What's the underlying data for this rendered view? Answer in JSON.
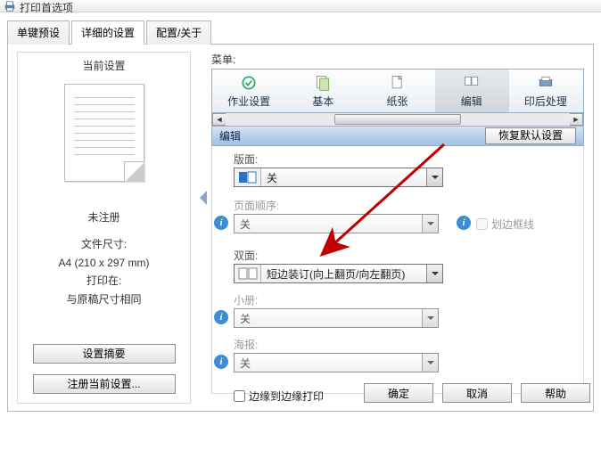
{
  "window": {
    "title": "打印首选项"
  },
  "tabs": {
    "preset": "单键预设",
    "detail": "详细的设置",
    "about": "配置/关于"
  },
  "left": {
    "heading": "当前设置",
    "unregistered": "未注册",
    "paperLabel": "文件尺寸:",
    "paperValue": "A4 (210 x 297 mm)",
    "printOnLabel": "打印在:",
    "printOnValue": "与原稿尺寸相同",
    "summaryBtn": "设置摘要",
    "registerBtn": "注册当前设置..."
  },
  "menuLabel": "菜单:",
  "toolbar": {
    "job": "作业设置",
    "basic": "基本",
    "paper": "纸张",
    "edit": "编辑",
    "finish": "印后处理"
  },
  "section": {
    "title": "编辑",
    "restore": "恢复默认设置"
  },
  "form": {
    "layoutLabel": "版面:",
    "layoutValue": "关",
    "orderLabel": "页面顺序:",
    "orderValue": "关",
    "borderLabel": "划边框线",
    "duplexLabel": "双面:",
    "duplexValue": "短边装订(向上翻页/向左翻页)",
    "bookletLabel": "小册:",
    "bookletValue": "关",
    "posterLabel": "海报:",
    "posterValue": "关",
    "edgeToEdge": "边缘到边缘打印"
  },
  "buttons": {
    "ok": "确定",
    "cancel": "取消",
    "help": "帮助"
  }
}
